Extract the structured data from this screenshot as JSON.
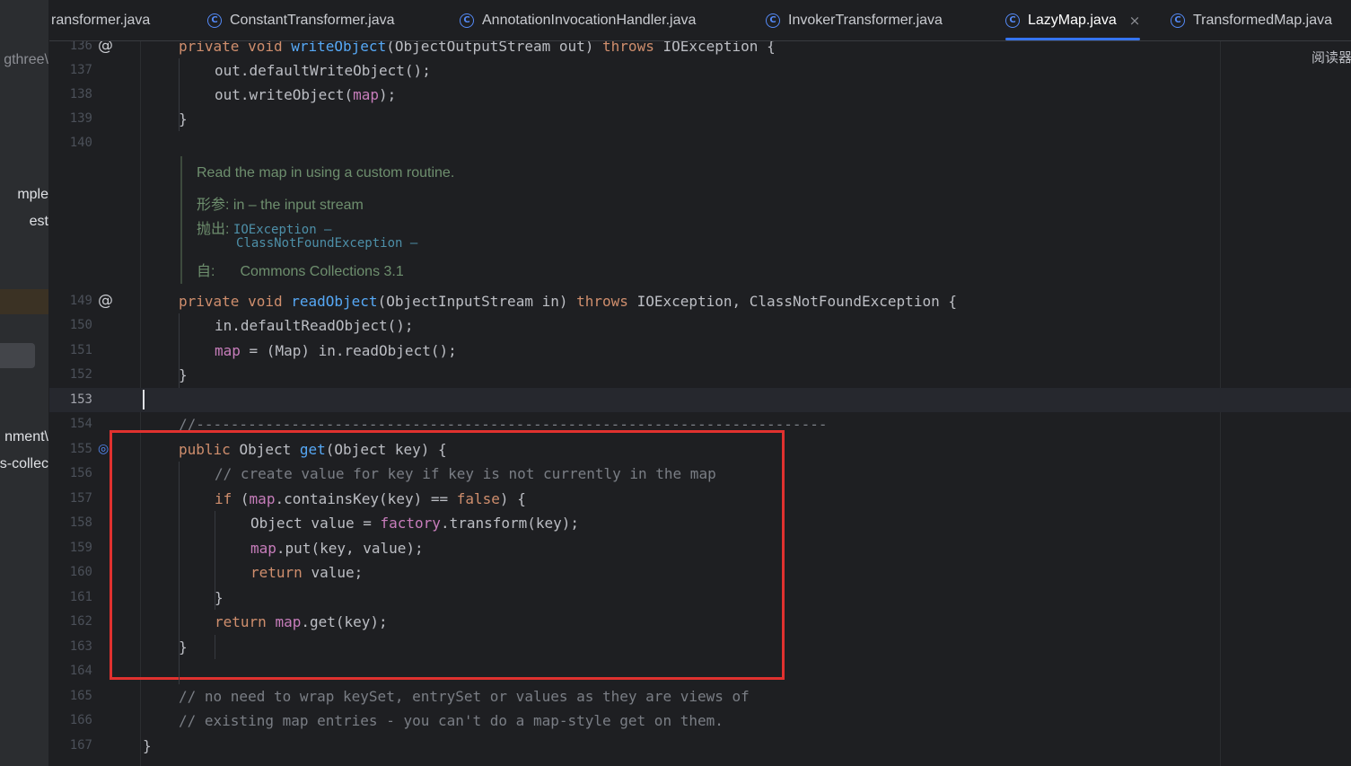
{
  "tabs": [
    {
      "label": "ransformer.java",
      "icon": "class-icon",
      "active": false,
      "show_icon": false
    },
    {
      "label": "ConstantTransformer.java",
      "icon": "class-icon",
      "active": false
    },
    {
      "label": "AnnotationInvocationHandler.java",
      "icon": "class-icon",
      "active": false
    },
    {
      "label": "InvokerTransformer.java",
      "icon": "class-icon",
      "active": false
    },
    {
      "label": "LazyMap.java",
      "icon": "class-icon",
      "active": true,
      "close": "×"
    },
    {
      "label": "TransformedMap.java",
      "icon": "class-icon",
      "active": false
    }
  ],
  "class_icon_glyph": "C",
  "left_panel": {
    "items": [
      "gthree\\",
      "mple",
      "est",
      "nment\\",
      "s-collec"
    ]
  },
  "reader_mode_label": "阅读器",
  "gutter_icons": {
    "implements": "@",
    "override": "◎"
  },
  "code_lines": [
    {
      "n": "136",
      "segments": [
        [
          "kw",
          "private "
        ],
        [
          "kw",
          "void "
        ],
        [
          "fn",
          "writeObject"
        ],
        [
          "ty",
          "(ObjectOutputStream out) "
        ],
        [
          "kw",
          "throws "
        ],
        [
          "ty",
          "IOException {"
        ]
      ],
      "indent": 1,
      "icon": "implements"
    },
    {
      "n": "137",
      "segments": [
        [
          "ty",
          "out.defaultWriteObject();"
        ]
      ],
      "indent": 2
    },
    {
      "n": "138",
      "segments": [
        [
          "ty",
          "out.writeObject("
        ],
        [
          "fld",
          "map"
        ],
        [
          "ty",
          ");"
        ]
      ],
      "indent": 2
    },
    {
      "n": "139",
      "segments": [
        [
          "ty",
          "}"
        ]
      ],
      "indent": 1
    },
    {
      "n": "140",
      "segments": [],
      "indent": 0
    },
    {
      "n": "149",
      "segments": [
        [
          "kw",
          "private "
        ],
        [
          "kw",
          "void "
        ],
        [
          "fn",
          "readObject"
        ],
        [
          "ty",
          "(ObjectInputStream in) "
        ],
        [
          "kw",
          "throws "
        ],
        [
          "ty",
          "IOException, ClassNotFoundException {"
        ]
      ],
      "indent": 1,
      "icon": "implements"
    },
    {
      "n": "150",
      "segments": [
        [
          "ty",
          "in.defaultReadObject();"
        ]
      ],
      "indent": 2
    },
    {
      "n": "151",
      "segments": [
        [
          "fld",
          "map"
        ],
        [
          "ty",
          " = (Map) in.readObject();"
        ]
      ],
      "indent": 2
    },
    {
      "n": "152",
      "segments": [
        [
          "ty",
          "}"
        ]
      ],
      "indent": 1
    },
    {
      "n": "153",
      "segments": [],
      "indent": 0,
      "current": true
    },
    {
      "n": "154",
      "segments": [
        [
          "cmt",
          "//-------------------------------------------------------------------------"
        ]
      ],
      "indent": 1
    },
    {
      "n": "155",
      "segments": [
        [
          "kw",
          "public "
        ],
        [
          "ty",
          "Object "
        ],
        [
          "fn",
          "get"
        ],
        [
          "ty",
          "(Object key) {"
        ]
      ],
      "indent": 1,
      "icon": "override"
    },
    {
      "n": "156",
      "segments": [
        [
          "cmt",
          "// create value for key if key is not currently in the map"
        ]
      ],
      "indent": 2
    },
    {
      "n": "157",
      "segments": [
        [
          "kw",
          "if "
        ],
        [
          "ty",
          "("
        ],
        [
          "fld",
          "map"
        ],
        [
          "ty",
          ".containsKey(key) == "
        ],
        [
          "kw",
          "false"
        ],
        [
          "ty",
          ") {"
        ]
      ],
      "indent": 2
    },
    {
      "n": "158",
      "segments": [
        [
          "ty",
          "Object value = "
        ],
        [
          "fld",
          "factory"
        ],
        [
          "ty",
          ".transform(key);"
        ]
      ],
      "indent": 3
    },
    {
      "n": "159",
      "segments": [
        [
          "fld",
          "map"
        ],
        [
          "ty",
          ".put(key, value);"
        ]
      ],
      "indent": 3
    },
    {
      "n": "160",
      "segments": [
        [
          "kw",
          "return "
        ],
        [
          "ty",
          "value;"
        ]
      ],
      "indent": 3
    },
    {
      "n": "161",
      "segments": [
        [
          "ty",
          "}"
        ]
      ],
      "indent": 2
    },
    {
      "n": "162",
      "segments": [
        [
          "kw",
          "return "
        ],
        [
          "fld",
          "map"
        ],
        [
          "ty",
          ".get(key);"
        ]
      ],
      "indent": 2
    },
    {
      "n": "163",
      "segments": [
        [
          "ty",
          "}"
        ]
      ],
      "indent": 1
    },
    {
      "n": "164",
      "segments": [],
      "indent": 0
    },
    {
      "n": "165",
      "segments": [
        [
          "cmt",
          "// no need to wrap keySet, entrySet or values as they are views of"
        ]
      ],
      "indent": 1
    },
    {
      "n": "166",
      "segments": [
        [
          "cmt",
          "// existing map entries - you can't do a map-style get on them."
        ]
      ],
      "indent": 1
    },
    {
      "n": "167",
      "segments": [
        [
          "ty",
          "}"
        ]
      ],
      "indent": 0
    }
  ],
  "doc": {
    "summary": "Read the map in using a custom routine.",
    "param_label": "形参:",
    "param_text": "in – the input stream",
    "throws_label": "抛出:",
    "throws_1": "IOException –",
    "throws_2": "ClassNotFoundException –",
    "since_label": "自:",
    "since_text": "Commons Collections 3.1"
  },
  "colors": {
    "keyword": "#cf8e6d",
    "method": "#56a8f5",
    "field": "#c77dbb",
    "comment": "#7a7e85",
    "highlight_box": "#e0312f",
    "accent": "#3574f0"
  }
}
